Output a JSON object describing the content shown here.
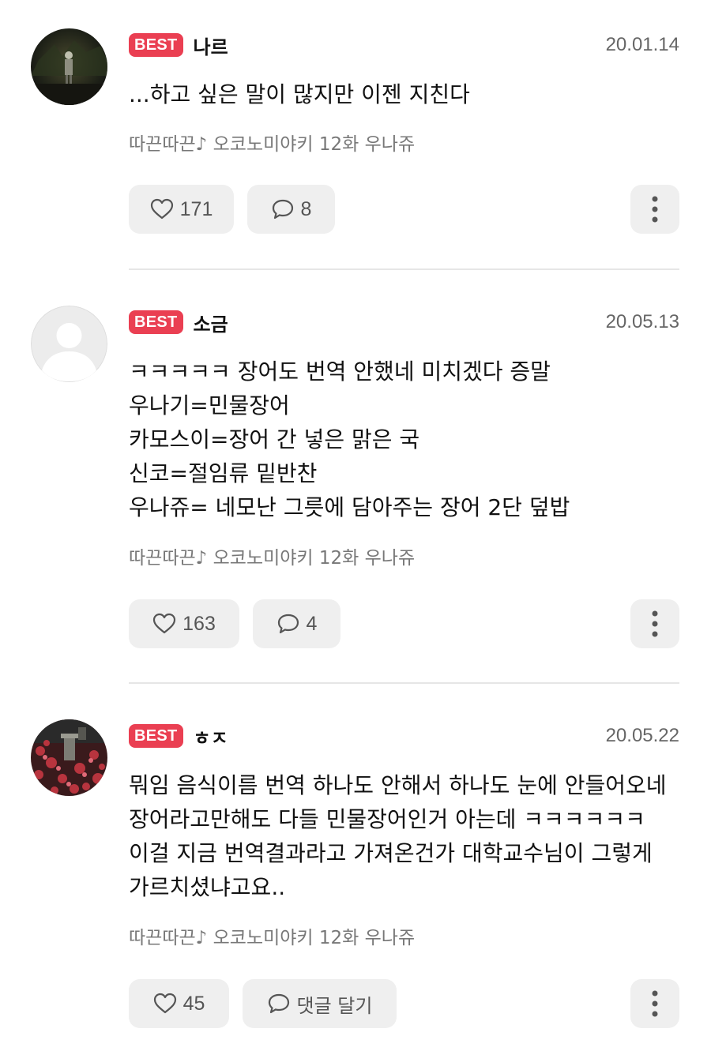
{
  "comments": [
    {
      "badge": "BEST",
      "author": "나르",
      "date": "20.01.14",
      "lines": [
        "...하고 싶은 말이 많지만 이젠 지친다"
      ],
      "source": "따끈따끈♪ 오코노미야키 12화 우나쥬",
      "likes": "171",
      "replies": "8"
    },
    {
      "badge": "BEST",
      "author": "소금",
      "date": "20.05.13",
      "lines": [
        "ㅋㅋㅋㅋㅋ 장어도 번역 안했네 미치겠다 증말",
        "우나기=민물장어",
        "카모스이=장어 간 넣은 맑은 국",
        "신코=절임류 밑반찬",
        "우나쥬= 네모난 그릇에 담아주는 장어 2단 덮밥"
      ],
      "source": "따끈따끈♪ 오코노미야키 12화 우나쥬",
      "likes": "163",
      "replies": "4"
    },
    {
      "badge": "BEST",
      "author": "ㅎㅈ",
      "date": "20.05.22",
      "lines": [
        "뭐임 음식이름 번역 하나도 안해서 하나도 눈에 안들어오네",
        "장어라고만해도 다들 민물장어인거 아는데 ㅋㅋㅋㅋㅋㅋ",
        "이걸 지금 번역결과라고 가져온건가 대학교수님이 그렇게",
        "가르치셨냐고요.."
      ],
      "source": "따끈따끈♪ 오코노미야키 12화 우나쥬",
      "likes": "45",
      "replies": "댓글 달기"
    }
  ],
  "icons": {
    "like": "heart-outline-icon",
    "reply": "speech-bubble-icon",
    "more": "vertical-dots-icon"
  },
  "colors": {
    "best_badge": "#ea3f52",
    "button_bg": "#efefef",
    "divider": "#e6e6e6"
  }
}
